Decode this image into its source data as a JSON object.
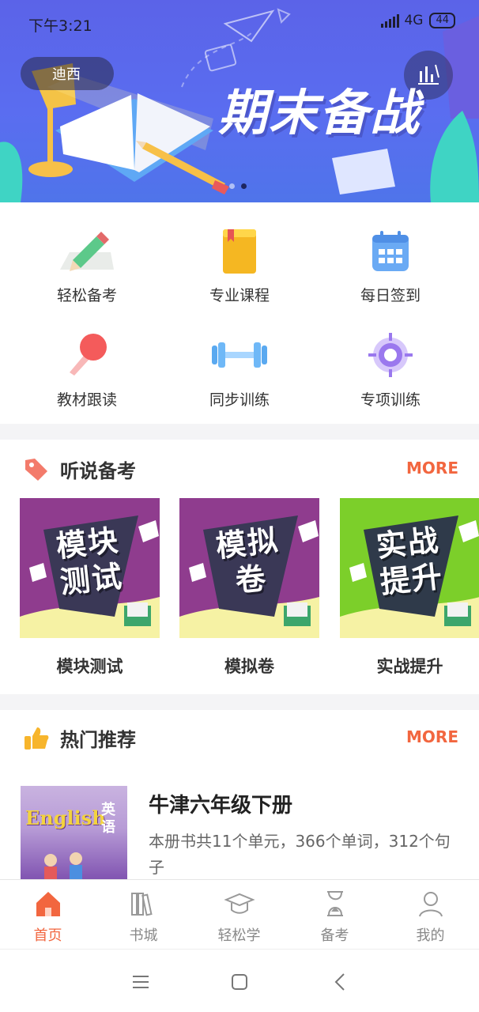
{
  "status_bar": {
    "time": "下午3:21",
    "network": "4G",
    "battery": "44"
  },
  "banner": {
    "location": "迪西",
    "headline": "期末备战",
    "dots": 2,
    "active_dot": 1
  },
  "features": [
    {
      "label": "轻松备考",
      "icon": "pencil-paper-icon"
    },
    {
      "label": "专业课程",
      "icon": "book-icon"
    },
    {
      "label": "每日签到",
      "icon": "calendar-icon"
    },
    {
      "label": "教材跟读",
      "icon": "microphone-icon"
    },
    {
      "label": "同步训练",
      "icon": "dumbbell-icon"
    },
    {
      "label": "专项训练",
      "icon": "target-icon"
    }
  ],
  "listening_section": {
    "title": "听说备考",
    "more": "MORE",
    "cards": [
      {
        "cover_line1": "模块",
        "cover_line2": "测试",
        "caption": "模块测试",
        "color": "#8f3c8e"
      },
      {
        "cover_line1": "模拟",
        "cover_line2": "卷",
        "caption": "模拟卷",
        "color": "#8f3c8e"
      },
      {
        "cover_line1": "实战",
        "cover_line2": "提升",
        "caption": "实战提升",
        "color": "#7ccf2a"
      }
    ]
  },
  "recommend_section": {
    "title": "热门推荐",
    "more": "MORE",
    "book": {
      "cover_word": "English",
      "cover_cn1": "英",
      "cover_cn2": "语",
      "title": "牛津六年级下册",
      "description": "本册书共11个单元，366个单词，312个句子"
    }
  },
  "tabbar": [
    {
      "label": "首页",
      "icon": "home-icon",
      "active": true
    },
    {
      "label": "书城",
      "icon": "bookshelf-icon",
      "active": false
    },
    {
      "label": "轻松学",
      "icon": "graduation-cap-icon",
      "active": false
    },
    {
      "label": "备考",
      "icon": "hourglass-icon",
      "active": false
    },
    {
      "label": "我的",
      "icon": "user-icon",
      "active": false
    }
  ],
  "colors": {
    "accent": "#f2663f",
    "banner": "#5b63e8"
  }
}
